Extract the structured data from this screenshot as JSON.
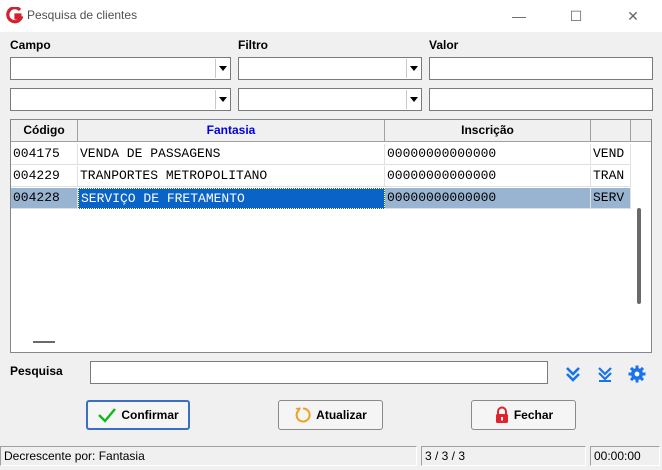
{
  "window": {
    "title": "Pesquisa de clientes",
    "minimize_glyph": "—",
    "maximize_glyph": "☐",
    "close_glyph": "✕",
    "logo_icon": "app-logo-icon",
    "logo_color": "#d3212f"
  },
  "filters": {
    "campo_label": "Campo",
    "filtro_label": "Filtro",
    "valor_label": "Valor",
    "rows": [
      {
        "campo": "",
        "filtro": "",
        "valor": ""
      },
      {
        "campo": "",
        "filtro": "",
        "valor": ""
      }
    ]
  },
  "grid": {
    "columns": [
      "Código",
      "Fantasia",
      "Inscrição",
      ""
    ],
    "sorted_column": "Fantasia",
    "rows": [
      {
        "codigo": "004175",
        "fantasia": "VENDA DE PASSAGENS",
        "inscricao": "00000000000000",
        "extra": "VEND"
      },
      {
        "codigo": "004229",
        "fantasia": "TRANPORTES METROPOLITANO",
        "inscricao": "00000000000000",
        "extra": "TRAN"
      },
      {
        "codigo": "004228",
        "fantasia": "SERVIÇO DE FRETAMENTO",
        "inscricao": "00000000000000",
        "extra": "SERV"
      }
    ],
    "selected_row": 2,
    "selection_color": "#0a64c8",
    "selected_row_color": "#99b4d1"
  },
  "search": {
    "label": "Pesquisa",
    "value": "",
    "icons": [
      "double-chevron-down-icon",
      "chevron-down-bar-icon",
      "gear-icon"
    ],
    "icon_color": "#1a73e8"
  },
  "buttons": {
    "confirm": "Confirmar",
    "refresh": "Atualizar",
    "close": "Fechar"
  },
  "status": {
    "sort": "Decrescente por: Fantasia",
    "count": "3 / 3 / 3",
    "time": "00:00:00"
  }
}
